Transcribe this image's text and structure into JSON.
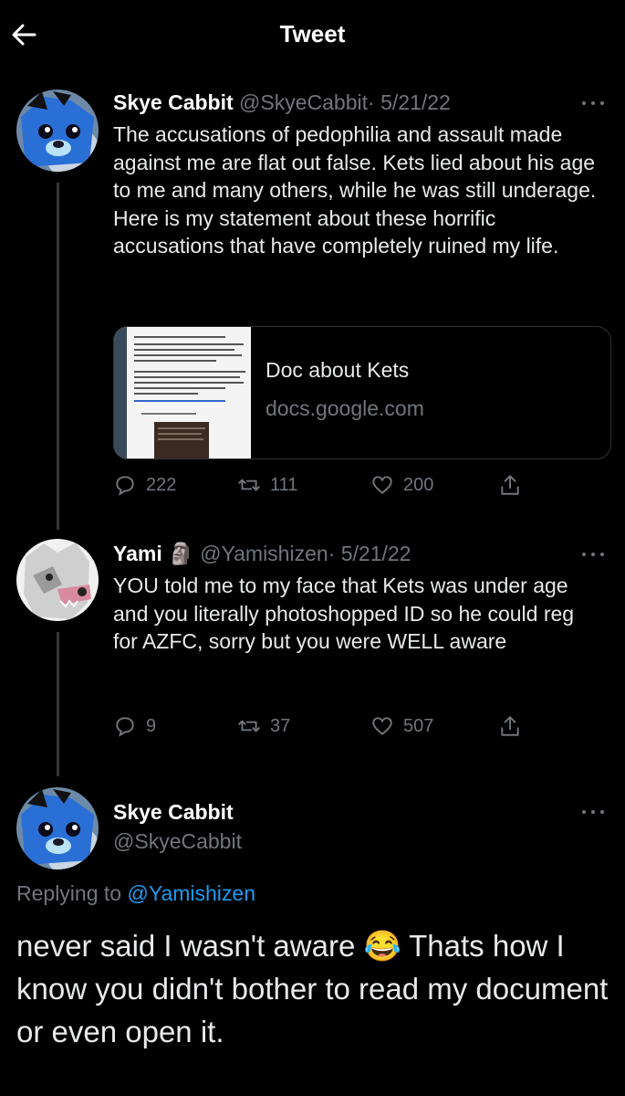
{
  "header": {
    "title": "Tweet",
    "back_icon": "arrow-left-icon"
  },
  "tweets": [
    {
      "name": "Skye Cabbit",
      "handle": "@SkyeCabbit",
      "date": "· 5/21/22",
      "text": "The accusations of pedophilia and assault made against me are flat out false. Kets lied about his age to me and many others, while he was still underage. Here is my statement about these horrific accusations that have completely ruined my life.",
      "card": {
        "title": "Doc about Kets",
        "domain": "docs.google.com"
      },
      "replies": "222",
      "retweets": "111",
      "likes": "200"
    },
    {
      "name": "Yami",
      "name_emoji": "🗿",
      "handle": "@Yamishizen",
      "date": "· 5/21/22",
      "text": "YOU told me to my face that Kets was under age and you literally photoshopped ID so he could reg for AZFC, sorry but you were WELL aware",
      "replies": "9",
      "retweets": "37",
      "likes": "507"
    }
  ],
  "focused": {
    "name": "Skye Cabbit",
    "handle": "@SkyeCabbit",
    "replying_label": "Replying to",
    "replying_to": "@Yamishizen",
    "text": "never said I wasn't aware 😂 Thats how I know you didn't bother to read my document or even open it."
  },
  "colors": {
    "background": "#000000",
    "link": "#1d9bf0",
    "muted": "#71767b"
  }
}
